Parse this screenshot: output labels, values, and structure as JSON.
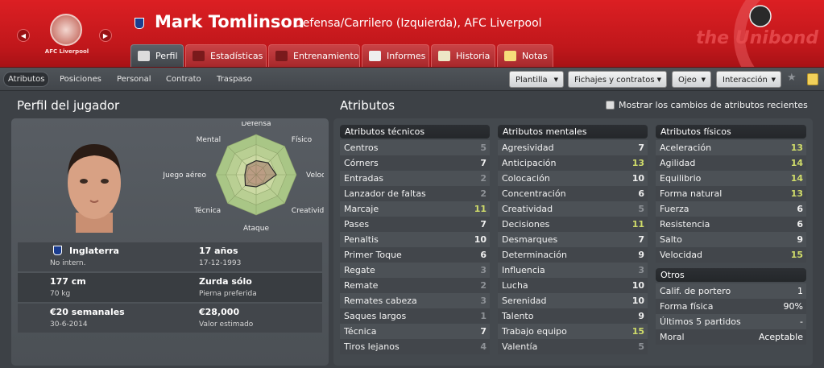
{
  "header": {
    "club_badge_label": "AFC Liverpool",
    "player_name": "Mark Tomlinson",
    "player_position": "Defensa/Carrilero (Izquierda), AFC Liverpool",
    "brand_text": "the Unibond league",
    "accent_color": "#c8191d"
  },
  "tabs": [
    {
      "label": "Perfil",
      "icon": "profile-card-icon",
      "active": true
    },
    {
      "label": "Estadísticas",
      "icon": "bar-chart-icon"
    },
    {
      "label": "Entrenamiento",
      "icon": "training-icon"
    },
    {
      "label": "Informes",
      "icon": "report-icon"
    },
    {
      "label": "Historia",
      "icon": "history-icon"
    },
    {
      "label": "Notas",
      "icon": "notes-icon"
    }
  ],
  "subtabs": [
    {
      "label": "Atributos",
      "active": true
    },
    {
      "label": "Posiciones"
    },
    {
      "label": "Personal"
    },
    {
      "label": "Contrato"
    },
    {
      "label": "Traspaso"
    }
  ],
  "menus": [
    "Plantilla",
    "Fichajes y contratos",
    "Ojeo",
    "Interacción"
  ],
  "profile": {
    "title": "Perfil del jugador",
    "radar_labels": [
      "Defensa",
      "Físico",
      "Velocidad",
      "Creatividad",
      "Ataque",
      "Técnica",
      "Juego aéreo",
      "Mental"
    ],
    "radar_values": [
      0.35,
      0.42,
      0.5,
      0.3,
      0.3,
      0.38,
      0.28,
      0.33
    ],
    "nationality": "Inglaterra",
    "intl_status": "No intern.",
    "age": "17 años",
    "birth_date": "17-12-1993",
    "height": "177 cm",
    "weight": "70 kg",
    "foot": "Zurda sólo",
    "foot_label": "Pierna preferida",
    "wage": "€20 semanales",
    "contract_end": "30-6-2014",
    "value": "€28,000",
    "value_label": "Valor estimado"
  },
  "attributes": {
    "title": "Atributos",
    "show_changes_label": "Mostrar los cambios de atributos recientes",
    "technical": {
      "header": "Atributos técnicos",
      "rows": [
        {
          "name": "Centros",
          "value": "5"
        },
        {
          "name": "Córners",
          "value": "7"
        },
        {
          "name": "Entradas",
          "value": "2"
        },
        {
          "name": "Lanzador de faltas",
          "value": "2"
        },
        {
          "name": "Marcaje",
          "value": "11"
        },
        {
          "name": "Pases",
          "value": "7"
        },
        {
          "name": "Penaltis",
          "value": "10"
        },
        {
          "name": "Primer Toque",
          "value": "6"
        },
        {
          "name": "Regate",
          "value": "3"
        },
        {
          "name": "Remate",
          "value": "2"
        },
        {
          "name": "Remates cabeza",
          "value": "3"
        },
        {
          "name": "Saques largos",
          "value": "1"
        },
        {
          "name": "Técnica",
          "value": "7"
        },
        {
          "name": "Tiros lejanos",
          "value": "4"
        }
      ]
    },
    "mental": {
      "header": "Atributos mentales",
      "rows": [
        {
          "name": "Agresividad",
          "value": "7"
        },
        {
          "name": "Anticipación",
          "value": "13"
        },
        {
          "name": "Colocación",
          "value": "10"
        },
        {
          "name": "Concentración",
          "value": "6"
        },
        {
          "name": "Creatividad",
          "value": "5"
        },
        {
          "name": "Decisiones",
          "value": "11"
        },
        {
          "name": "Desmarques",
          "value": "7"
        },
        {
          "name": "Determinación",
          "value": "9"
        },
        {
          "name": "Influencia",
          "value": "3"
        },
        {
          "name": "Lucha",
          "value": "10"
        },
        {
          "name": "Serenidad",
          "value": "10"
        },
        {
          "name": "Talento",
          "value": "9"
        },
        {
          "name": "Trabajo equipo",
          "value": "15"
        },
        {
          "name": "Valentía",
          "value": "5"
        }
      ]
    },
    "physical": {
      "header": "Atributos físicos",
      "rows": [
        {
          "name": "Aceleración",
          "value": "13"
        },
        {
          "name": "Agilidad",
          "value": "14"
        },
        {
          "name": "Equilibrio",
          "value": "14"
        },
        {
          "name": "Forma natural",
          "value": "13"
        },
        {
          "name": "Fuerza",
          "value": "6"
        },
        {
          "name": "Resistencia",
          "value": "6"
        },
        {
          "name": "Salto",
          "value": "9"
        },
        {
          "name": "Velocidad",
          "value": "15"
        }
      ]
    },
    "others": {
      "header": "Otros",
      "rows": [
        {
          "name": "Calif. de portero",
          "value": "1"
        },
        {
          "name": "Forma física",
          "value": "90%"
        },
        {
          "name": "Últimos 5 partidos",
          "value": "-"
        },
        {
          "name": "Moral",
          "value": "Aceptable"
        }
      ]
    }
  }
}
